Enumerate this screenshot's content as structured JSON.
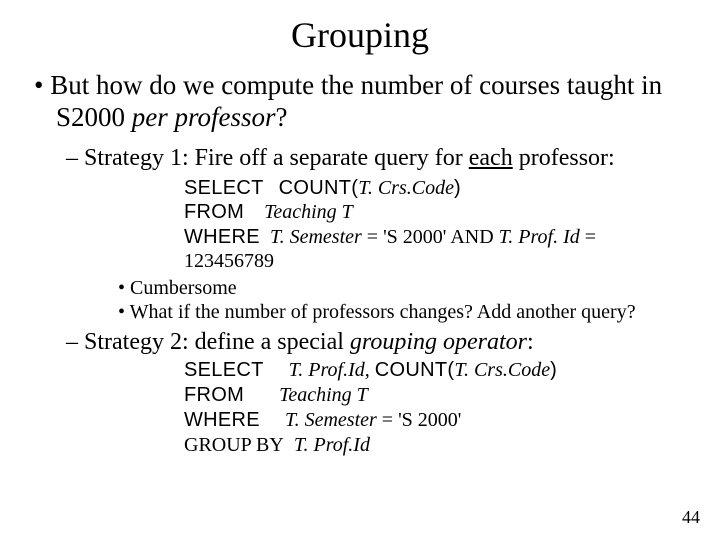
{
  "title": "Grouping",
  "bullet1_a": "But how do we compute the number of courses taught in S2000 ",
  "bullet1_b": "per professor",
  "bullet1_c": "?",
  "strategy1_a": "Strategy 1:  Fire off a separate query for ",
  "strategy1_b": "each",
  "strategy1_c": " professor:",
  "code1": {
    "select_kw": "SELECT",
    "count_kw": "COUNT(",
    "count_arg": "T. Crs.Code",
    "count_close": ")",
    "from_kw": "FROM",
    "from_arg": "Teaching T",
    "where_kw": "WHERE",
    "where_a": "T. Semester",
    "where_eq": " = 'S 2000' ",
    "and_kw": "AND",
    "where_b": " T. Prof. Id",
    "where_val": " = 123456789"
  },
  "sub1": "Cumbersome",
  "sub2": "What if the number of professors changes?  Add another query?",
  "strategy2_a": "Strategy 2:  define a special ",
  "strategy2_b": "grouping operator",
  "strategy2_c": ":",
  "code2": {
    "select_kw": "SELECT",
    "select_arg_a": "T. Prof.Id",
    "select_comma": ",  ",
    "count_kw": "COUNT(",
    "count_arg": "T. Crs.Code",
    "count_close": ")",
    "from_kw": "FROM",
    "from_arg": "Teaching  T",
    "where_kw": "WHERE",
    "where_a": "T. Semester",
    "where_eq": " = 'S 2000'",
    "groupby_kw": "GROUP BY",
    "groupby_arg": "T. Prof.Id"
  },
  "page_num": "44"
}
